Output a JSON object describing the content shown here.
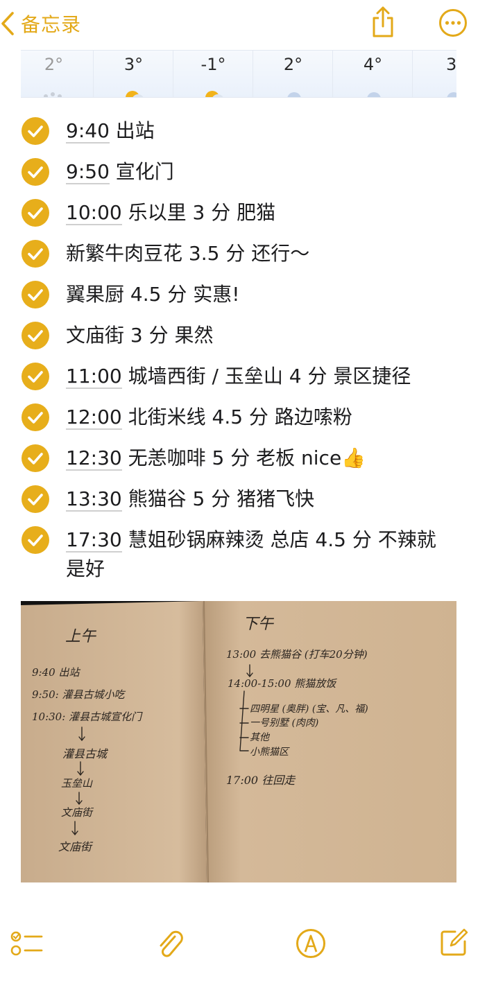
{
  "nav": {
    "back_label": "备忘录",
    "back_icon": "chevron-left-icon",
    "share_icon": "share-icon",
    "more_icon": "ellipsis-circle-icon"
  },
  "weather": {
    "temps": [
      "2°",
      "3°",
      "-1°",
      "2°",
      "4°",
      "3"
    ]
  },
  "checklist": {
    "items": [
      {
        "time": "9:40",
        "text": " 出站",
        "checked": true
      },
      {
        "time": "9:50",
        "text": " 宣化门",
        "checked": true
      },
      {
        "time": "10:00",
        "text": " 乐以里 3 分 肥猫",
        "checked": true
      },
      {
        "time": "",
        "text": "新繁牛肉豆花 3.5 分 还行～",
        "checked": true
      },
      {
        "time": "",
        "text": "翼果厨 4.5 分 实惠!",
        "checked": true
      },
      {
        "time": "",
        "text": "文庙街 3 分 果然",
        "checked": true
      },
      {
        "time": "11:00",
        "text": " 城墙西街 / 玉垒山 4 分 景区捷径",
        "checked": true
      },
      {
        "time": "12:00",
        "text": " 北街米线 4.5 分 路边嗦粉",
        "checked": true
      },
      {
        "time": "12:30",
        "text": " 无恙咖啡 5 分 老板 nice",
        "checked": true,
        "emoji": "👍"
      },
      {
        "time": "13:30",
        "text": " 熊猫谷 5 分 猪猪飞快",
        "checked": true
      },
      {
        "time": "17:30",
        "text": " 慧姐砂锅麻辣烫 总店 4.5 分 不辣就是好",
        "checked": true
      }
    ]
  },
  "photo": {
    "left_page": {
      "heading": "上午",
      "lines": [
        "9:40 出站",
        "9:50: 灌县古城小吃",
        "10:30: 灌县古城宣化门",
        "灌县古城",
        "玉垒山",
        "文庙街",
        "文庙街"
      ]
    },
    "right_page": {
      "heading": "下午",
      "lines": [
        "13:00 去熊猫谷 (打车20分钟)",
        "14:00-15:00 熊猫放饭",
        "四明星 (奥胖) (宝、凡、福)",
        "一号别墅 (肉肉)",
        "其他",
        "小熊猫区",
        "17:00 往回走"
      ]
    }
  },
  "toolbar": {
    "checklist_icon": "checklist-icon",
    "attach_icon": "paperclip-icon",
    "markup_icon": "pen-circle-icon",
    "compose_icon": "compose-icon"
  },
  "colors": {
    "accent": "#e3a919",
    "check_fill": "#e7ae1b"
  }
}
